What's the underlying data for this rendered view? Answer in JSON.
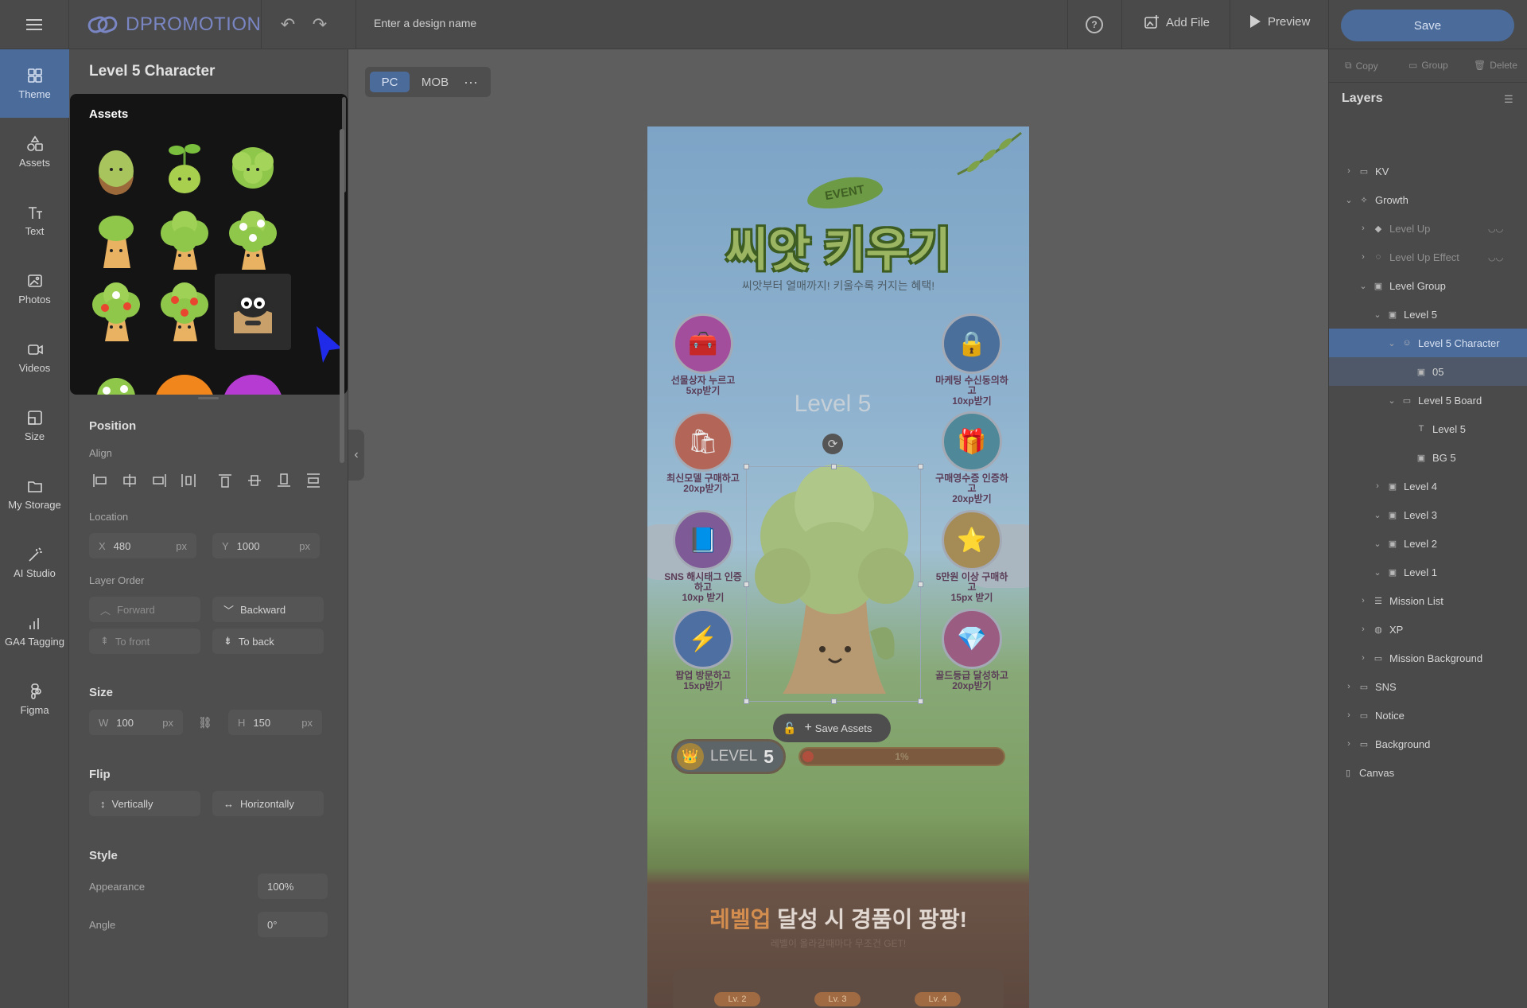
{
  "topbar": {
    "logo_text": "DPROMOTION",
    "design_name_placeholder": "Enter a design name",
    "help_label": "?",
    "add_file_label": "Add File",
    "preview_label": "Preview",
    "save_label": "Save"
  },
  "rail": {
    "items": [
      {
        "label": "Theme",
        "icon": "layout-icon",
        "active": true
      },
      {
        "label": "Assets",
        "icon": "shapes-icon"
      },
      {
        "label": "Text",
        "icon": "text-icon"
      },
      {
        "label": "Photos",
        "icon": "photo-icon"
      },
      {
        "label": "Videos",
        "icon": "video-icon"
      },
      {
        "label": "Size",
        "icon": "resize-icon"
      },
      {
        "label": "My Storage",
        "icon": "folder-icon"
      },
      {
        "label": "AI Studio",
        "icon": "magic-wand-icon"
      },
      {
        "label": "GA4 Tagging",
        "icon": "analytics-icon"
      },
      {
        "label": "Figma",
        "icon": "figma-icon"
      }
    ]
  },
  "props": {
    "title": "Level 5 Character",
    "assets_title": "Assets",
    "position_title": "Position",
    "align_label": "Align",
    "location_label": "Location",
    "x_label": "X",
    "x_value": "480",
    "y_label": "Y",
    "y_value": "1000",
    "unit": "px",
    "layer_order_label": "Layer Order",
    "forward_label": "Forward",
    "backward_label": "Backward",
    "to_front_label": "To front",
    "to_back_label": "To back",
    "size_title": "Size",
    "w_label": "W",
    "w_value": "100",
    "h_label": "H",
    "h_value": "150",
    "flip_title": "Flip",
    "vertically_label": "Vertically",
    "horizontally_label": "Horizontally",
    "style_title": "Style",
    "appearance_label": "Appearance",
    "appearance_value": "100%",
    "angle_label": "Angle",
    "angle_value": "0°"
  },
  "device": {
    "pc": "PC",
    "mob": "MOB",
    "more": "···"
  },
  "page": {
    "event_label": "EVENT",
    "title": "씨앗 키우기",
    "subtitle": "씨앗부터 열매까지! 키울수록 커지는 혜택!",
    "missions_left": [
      {
        "line1": "선물상자 누르고",
        "line2": "5xp받기",
        "icon": "🧰"
      },
      {
        "line1": "최신모델 구매하고",
        "line2": "20xp받기",
        "icon": "🛍"
      },
      {
        "line1": "SNS 해시태그 인증하고",
        "line2": "10xp 받기",
        "icon": "📘"
      },
      {
        "line1": "팝업 방문하고",
        "line2": "15xp받기",
        "icon": "⚡"
      }
    ],
    "missions_right": [
      {
        "line1": "마케팅 수신동의하고",
        "line2": "10xp받기",
        "icon": "🔒"
      },
      {
        "line1": "구매영수증 인증하고",
        "line2": "20xp받기",
        "icon": "🎁"
      },
      {
        "line1": "5만원 이상 구매하고",
        "line2": "15px 받기",
        "icon": "⭐"
      },
      {
        "line1": "골드등급 달성하고",
        "line2": "20xp받기",
        "icon": "💎"
      }
    ],
    "level_text": "Level 5",
    "rotate_icon": "⟳",
    "save_assets_label": "Save Assets",
    "level_word": "LEVEL",
    "level_num": "5",
    "xp_percent": 1,
    "xp_text": "1%",
    "banner_accent": "레벨업",
    "banner_rest": " 달성 시 경품이 팡팡!",
    "banner_sub": "레벨이 올라갈때마다 무조건 GET!",
    "lv_tags": [
      "Lv. 2",
      "Lv. 3",
      "Lv. 4"
    ]
  },
  "layers": {
    "copy_label": "Copy",
    "group_label": "Group",
    "delete_label": "Delete",
    "title": "Layers",
    "rows": [
      {
        "label": "KV",
        "depth": 0,
        "chev": "›",
        "icon": "folder"
      },
      {
        "label": "Growth",
        "depth": 0,
        "chev": "⌄",
        "icon": "sparkle"
      },
      {
        "label": "Level Up",
        "depth": 1,
        "chev": "›",
        "icon": "drop",
        "dim": true,
        "hidden": true
      },
      {
        "label": "Level Up Effect",
        "depth": 1,
        "chev": "›",
        "icon": "dash",
        "dim": true,
        "hidden": true
      },
      {
        "label": "Level Group",
        "depth": 1,
        "chev": "⌄",
        "icon": "image"
      },
      {
        "label": "Level 5",
        "depth": 2,
        "chev": "⌄",
        "icon": "image"
      },
      {
        "label": "Level 5 Character",
        "depth": 3,
        "chev": "⌄",
        "icon": "smile",
        "sel": true
      },
      {
        "label": "05",
        "depth": 4,
        "chev": "",
        "icon": "image",
        "sel2": true
      },
      {
        "label": "Level 5 Board",
        "depth": 3,
        "chev": "⌄",
        "icon": "board"
      },
      {
        "label": "Level 5",
        "depth": 4,
        "chev": "",
        "icon": "text"
      },
      {
        "label": "BG 5",
        "depth": 4,
        "chev": "",
        "icon": "image"
      },
      {
        "label": "Level 4",
        "depth": 2,
        "chev": "›",
        "icon": "image"
      },
      {
        "label": "Level 3",
        "depth": 2,
        "chev": "⌄",
        "icon": "image"
      },
      {
        "label": "Level 2",
        "depth": 2,
        "chev": "⌄",
        "icon": "image"
      },
      {
        "label": "Level 1",
        "depth": 2,
        "chev": "⌄",
        "icon": "image"
      },
      {
        "label": "Mission List",
        "depth": 1,
        "chev": "›",
        "icon": "list"
      },
      {
        "label": "XP",
        "depth": 1,
        "chev": "›",
        "icon": "badge"
      },
      {
        "label": "Mission Background",
        "depth": 1,
        "chev": "›",
        "icon": "folder"
      },
      {
        "label": "SNS",
        "depth": 0,
        "chev": "›",
        "icon": "folder"
      },
      {
        "label": "Notice",
        "depth": 0,
        "chev": "›",
        "icon": "folder"
      },
      {
        "label": "Background",
        "depth": 0,
        "chev": "›",
        "icon": "folder"
      },
      {
        "label": "Canvas",
        "depth": -1,
        "chev": "",
        "icon": "rect"
      }
    ]
  }
}
